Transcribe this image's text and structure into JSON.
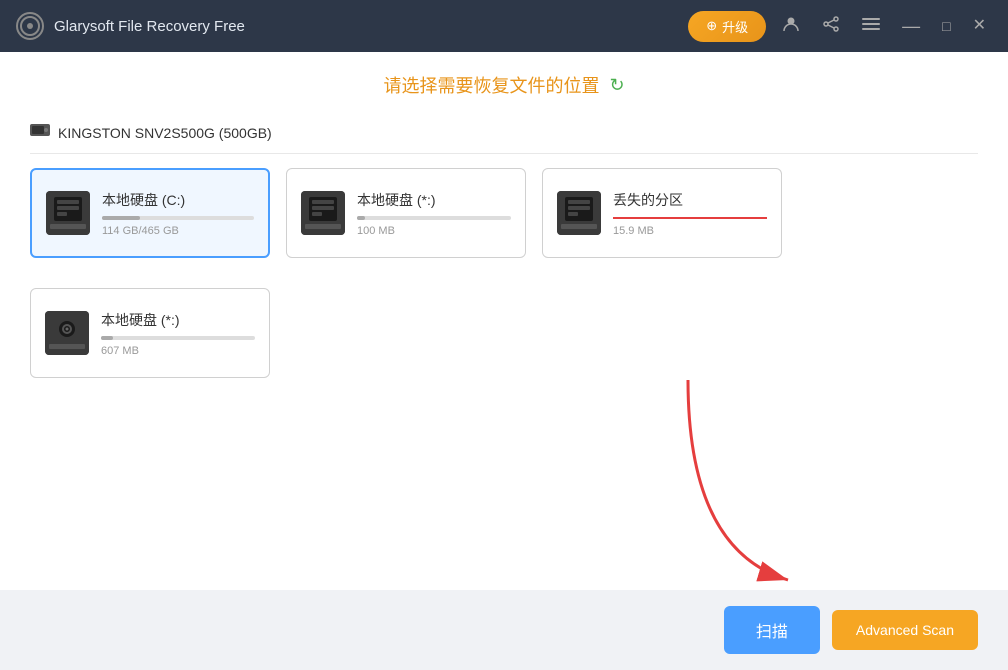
{
  "titleBar": {
    "logo": "G",
    "title": "Glarysoft File Recovery Free",
    "upgradeLabel": "升级",
    "icons": {
      "user": "👤",
      "share": "⋮",
      "menu": "≡",
      "minimize": "—",
      "maximize": "□",
      "close": "✕"
    }
  },
  "pageHeader": {
    "title": "请选择需要恢复文件的位置",
    "refreshIcon": "↻"
  },
  "diskSection": {
    "diskName": "KINGSTON SNV2S500G (500GB)",
    "partitions": [
      {
        "label": "本地硬盘 (C:)",
        "size": "114 GB/465 GB",
        "barFill": 25,
        "selected": true,
        "lost": false
      },
      {
        "label": "本地硬盘 (*:)",
        "size": "100 MB",
        "barFill": 5,
        "selected": false,
        "lost": false
      },
      {
        "label": "丢失的分区",
        "size": "15.9 MB",
        "barFill": 3,
        "selected": false,
        "lost": true
      }
    ]
  },
  "diskSection2": {
    "partitions": [
      {
        "label": "本地硬盘 (*:)",
        "size": "607 MB",
        "barFill": 8,
        "selected": false,
        "lost": false
      }
    ]
  },
  "footer": {
    "scanLabel": "扫描",
    "advancedScanLabel": "Advanced Scan"
  }
}
